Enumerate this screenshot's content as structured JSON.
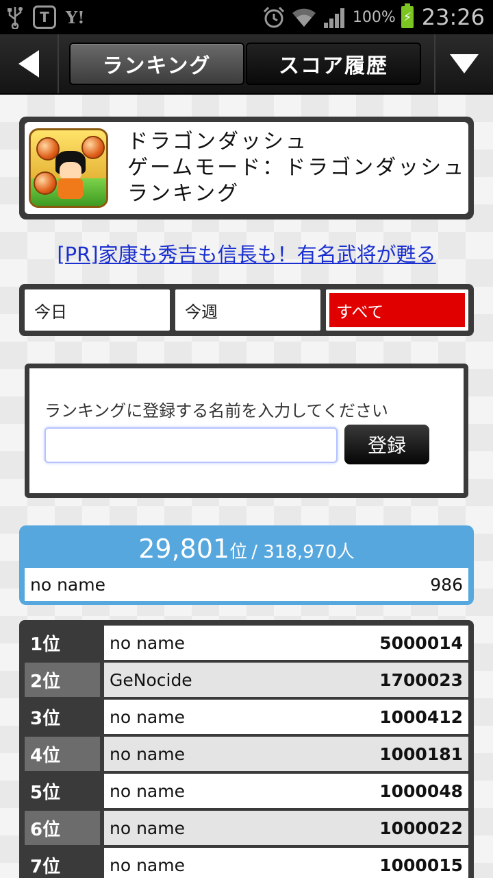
{
  "status_bar": {
    "icons": [
      "usb-icon",
      "t-app-icon",
      "yahoo-icon",
      "alarm-icon",
      "wifi-icon",
      "signal-icon",
      "battery-icon"
    ],
    "t_badge": "T",
    "yahoo": "Y!",
    "battery_pct": "100%",
    "time": "23:26"
  },
  "nav": {
    "tabs": [
      {
        "label": "ランキング",
        "active": true
      },
      {
        "label": "スコア履歴",
        "active": false
      }
    ]
  },
  "game": {
    "title_line1": "ドラゴンダッシュ",
    "title_line2": "ゲームモード：ドラゴンダッシュ",
    "title_line3": "ランキング"
  },
  "ad": {
    "text": "[PR]家康も秀吉も信長も！有名武将が甦る"
  },
  "period": {
    "options": [
      "今日",
      "今週",
      "すべて"
    ],
    "selected": "すべて"
  },
  "register": {
    "label": "ランキングに登録する名前を入力してください",
    "input_value": "",
    "button_label": "登録"
  },
  "my_rank": {
    "rank": "29,801",
    "rank_unit": "位",
    "total": "/ 318,970人",
    "name": "no name",
    "score": "986"
  },
  "ranking": [
    {
      "pos": "1位",
      "name": "no name",
      "score": "5000014"
    },
    {
      "pos": "2位",
      "name": "GeNocide",
      "score": "1700023"
    },
    {
      "pos": "3位",
      "name": "no name",
      "score": "1000412"
    },
    {
      "pos": "4位",
      "name": "no name",
      "score": "1000181"
    },
    {
      "pos": "5位",
      "name": "no name",
      "score": "1000048"
    },
    {
      "pos": "6位",
      "name": "no name",
      "score": "1000022"
    },
    {
      "pos": "7位",
      "name": "no name",
      "score": "1000015"
    }
  ],
  "colors": {
    "accent_red": "#e00000",
    "my_rank_blue": "#55a7de",
    "link_blue": "#1a2fd0",
    "battery_green": "#7cc421"
  }
}
